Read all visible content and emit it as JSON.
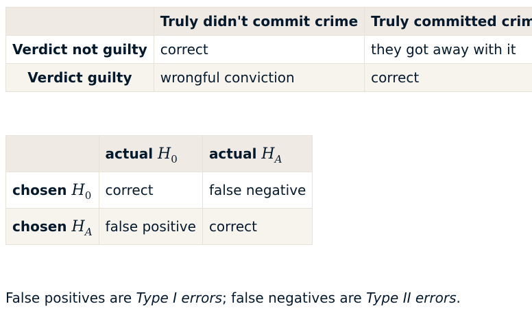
{
  "table1": {
    "headers": [
      "",
      "Truly didn't commit crime",
      "Truly committed crime"
    ],
    "rows": [
      {
        "label": "Verdict not guilty",
        "cells": [
          "correct",
          "they got away with it"
        ]
      },
      {
        "label": "Verdict guilty",
        "cells": [
          "wrongful conviction",
          "correct"
        ]
      }
    ]
  },
  "table2": {
    "headers": [
      {
        "text": "",
        "math_base": "",
        "math_sub": ""
      },
      {
        "text": "actual ",
        "math_base": "H",
        "math_sub": "0"
      },
      {
        "text": "actual ",
        "math_base": "H",
        "math_sub": "A"
      }
    ],
    "rows": [
      {
        "label_text": "chosen ",
        "math_base": "H",
        "math_sub": "0",
        "cells": [
          "correct",
          "false negative"
        ]
      },
      {
        "label_text": "chosen ",
        "math_base": "H",
        "math_sub": "A",
        "cells": [
          "false positive",
          "correct"
        ]
      }
    ]
  },
  "note": {
    "part1": "False positives are ",
    "em1": "Type I errors",
    "part2": "; false negatives are ",
    "em2": "Type II errors",
    "part3": "."
  }
}
